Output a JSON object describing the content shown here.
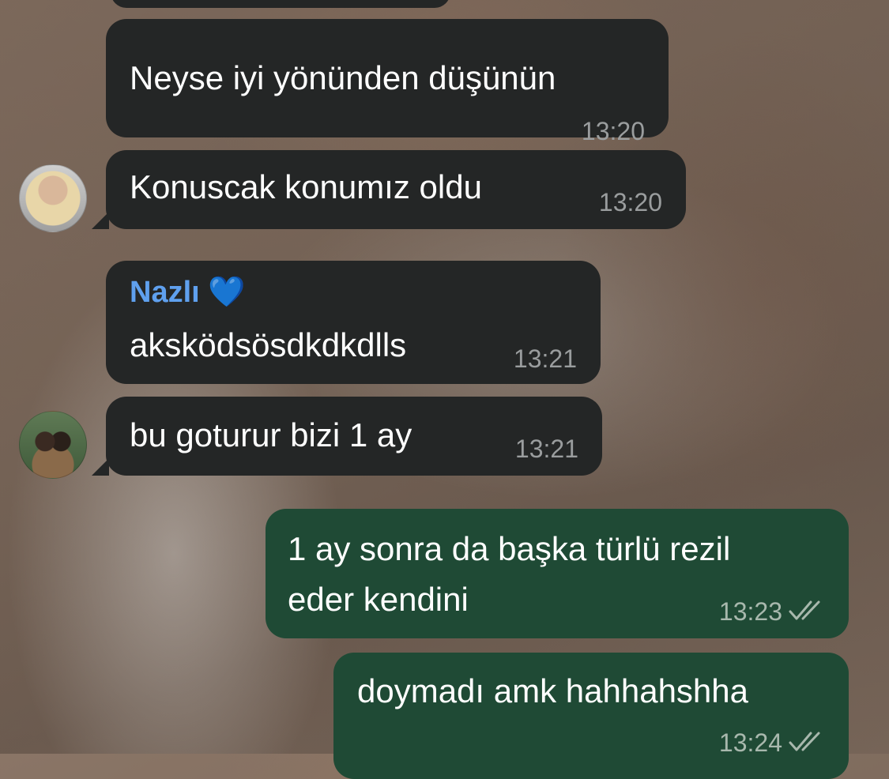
{
  "messages": [
    {
      "text": "Neyse iyi yönünden düşünün",
      "time": "13:20"
    },
    {
      "text": "Konuscak konumız oldu",
      "time": "13:20"
    },
    {
      "sender": "Nazlı 💙",
      "text": "aksködsösdkdkdlls",
      "time": "13:21"
    },
    {
      "text": "bu goturur bizi 1 ay",
      "time": "13:21"
    },
    {
      "text_line1": "1 ay sonra da başka türlü rezil",
      "text_line2": "eder kendini",
      "time": "13:23"
    },
    {
      "text": "doymadı amk hahhahshha",
      "time": "13:24"
    }
  ],
  "colors": {
    "incoming_bubble": "#242626",
    "outgoing_bubble": "#1f4a35",
    "sender_name": "#5fa0ee",
    "timestamp": "#9a9d9e"
  },
  "icons": {
    "read_receipt": "double-check-icon",
    "avatar_1": "avatar",
    "avatar_2": "avatar"
  }
}
